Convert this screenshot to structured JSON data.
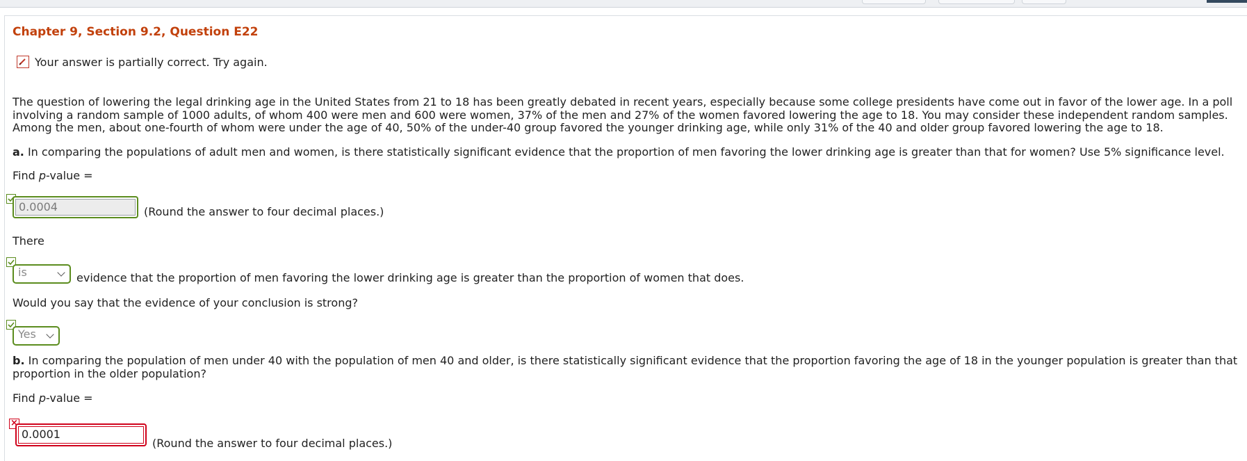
{
  "header": {
    "question_title": "Chapter 9, Section 9.2, Question E22",
    "status_message": "Your answer is partially correct.  Try again."
  },
  "problem": {
    "text": "The question of lowering the legal drinking age in the United States from 21 to 18 has been greatly debated in recent years, especially because some college presidents have come out in favor of the lower age. In a poll involving a random sample of 1000 adults, of whom 400 were men and 600 were women, 37% of the men and 27% of the women favored lowering the age to 18. You may consider these independent random samples. Among the men, about one-fourth of whom were under the age of 40, 50% of the under-40 group favored the younger drinking age, while only 31% of the 40 and older group favored lowering the age to 18."
  },
  "part_a": {
    "label": "a.",
    "question": " In comparing the populations of adult men and women, is there statistically significant evidence that the proportion of men favoring the lower drinking age is greater than that for women? Use 5% significance level.",
    "find_prefix": "Find ",
    "find_var": "p",
    "find_suffix": "-value =",
    "pvalue_answer": "0.0004",
    "round_hint": "(Round the answer to four decimal places.)",
    "there_label": "There",
    "evidence_select": "is",
    "evidence_text": "evidence that the proportion of men favoring the lower drinking age is greater than the proportion of women that does.",
    "strong_question": "Would you say that the evidence of your conclusion is strong?",
    "strong_select": "Yes"
  },
  "part_b": {
    "label": "b.",
    "question": " In comparing the population of men under 40 with the population of men 40 and older, is there statistically significant evidence that the proportion favoring the age of 18 in the younger population is greater than that proportion in the older population?",
    "find_prefix": "Find ",
    "find_var": "p",
    "find_suffix": "-value =",
    "pvalue_answer": "0.0001",
    "round_hint": "(Round the answer to four decimal places.)"
  },
  "colors": {
    "title": "#c2410c",
    "correct": "#5b8c1e",
    "incorrect": "#d0021b"
  },
  "icons": {
    "status": "pencil-edit-icon",
    "correct": "check-icon",
    "incorrect": "x-icon"
  }
}
